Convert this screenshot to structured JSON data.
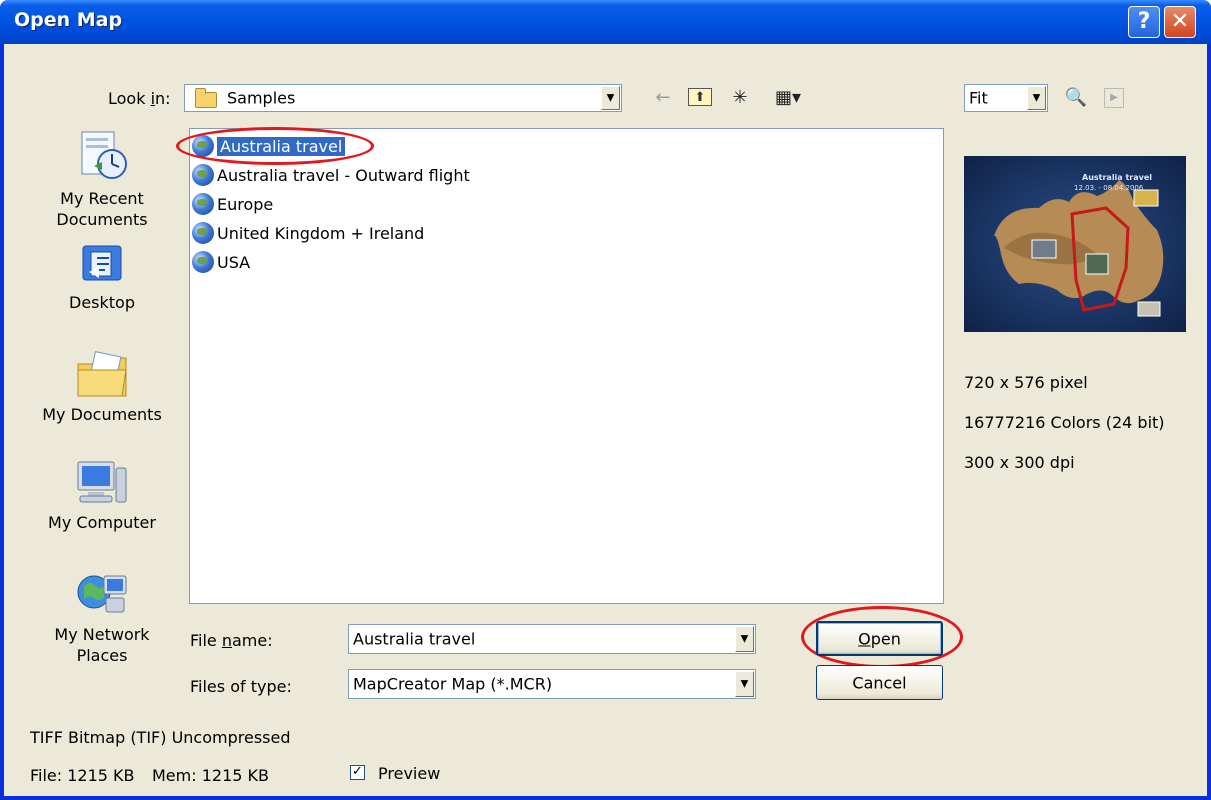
{
  "window": {
    "title": "Open Map",
    "help_button": "?",
    "close_button": "✕"
  },
  "look_in": {
    "label_prefix": "Look ",
    "label_hotkey": "i",
    "label_suffix": "n:",
    "value": "Samples"
  },
  "toolbar": {
    "back_icon": "←",
    "up_icon": "⬆",
    "new_folder_icon": "✳",
    "views_icon": "▦▾"
  },
  "preview_controls": {
    "zoom_value": "Fit",
    "inspect_icon": "🔍",
    "play_icon": "▶"
  },
  "places": [
    {
      "label": "My Recent\nDocuments",
      "icon": "recent-documents-icon"
    },
    {
      "label": "Desktop",
      "icon": "desktop-icon"
    },
    {
      "label": "My Documents",
      "icon": "my-documents-icon"
    },
    {
      "label": "My Computer",
      "icon": "my-computer-icon"
    },
    {
      "label": "My Network\nPlaces",
      "icon": "network-places-icon"
    }
  ],
  "files": [
    {
      "name": "Australia travel",
      "selected": true
    },
    {
      "name": "Australia travel - Outward flight",
      "selected": false
    },
    {
      "name": "Europe",
      "selected": false
    },
    {
      "name": "United Kingdom + Ireland",
      "selected": false
    },
    {
      "name": "USA",
      "selected": false
    }
  ],
  "file_name": {
    "label_prefix": "File ",
    "label_hotkey": "n",
    "label_suffix": "ame:",
    "value": "Australia travel"
  },
  "file_type": {
    "label": "Files of type:",
    "value": "MapCreator Map (*.MCR)"
  },
  "buttons": {
    "open_hotkey": "O",
    "open_rest": "pen",
    "cancel": "Cancel"
  },
  "preview_info": {
    "map_title": "Australia travel",
    "map_dates": "12.03. - 08.04.2006",
    "dimensions": "720 x 576 pixel",
    "colors": "16777216 Colors (24 bit)",
    "dpi": "300 x 300 dpi"
  },
  "status": {
    "format": "TIFF Bitmap (TIF) Uncompressed",
    "file_size": "File: 1215 KB",
    "mem_size": "Mem: 1215 KB"
  },
  "preview_checkbox": {
    "label": "Preview",
    "checked": true
  },
  "colors": {
    "title_bar": "#0054e3",
    "dialog_bg": "#ece9d8",
    "selection": "#316ac5",
    "annotation_red": "#e2181d"
  }
}
